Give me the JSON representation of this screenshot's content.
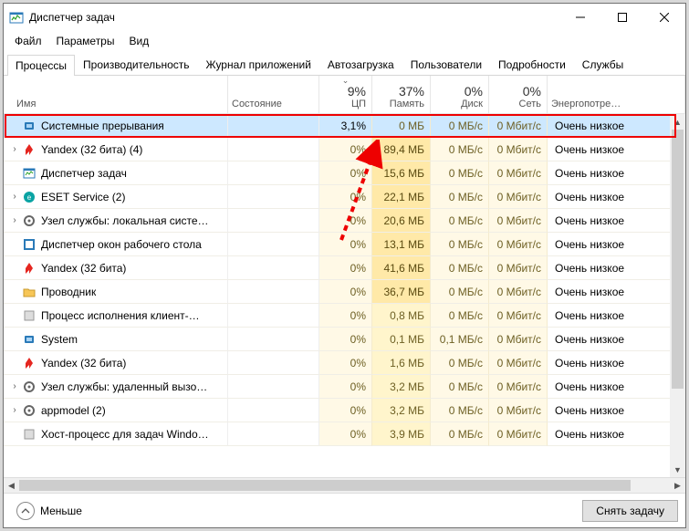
{
  "window": {
    "title": "Диспетчер задач"
  },
  "menu": {
    "file": "Файл",
    "options": "Параметры",
    "view": "Вид"
  },
  "tabs": {
    "processes": "Процессы",
    "performance": "Производительность",
    "apphistory": "Журнал приложений",
    "startup": "Автозагрузка",
    "users": "Пользователи",
    "details": "Подробности",
    "services": "Службы"
  },
  "columns": {
    "name": "Имя",
    "status": "Состояние",
    "cpu": {
      "value": "9%",
      "label": "ЦП"
    },
    "mem": {
      "value": "37%",
      "label": "Память"
    },
    "disk": {
      "value": "0%",
      "label": "Диск"
    },
    "net": {
      "value": "0%",
      "label": "Сеть"
    },
    "power": "Энергопотре…"
  },
  "rows": [
    {
      "icon": "system",
      "expandable": false,
      "selected": true,
      "name": "Системные прерывания",
      "cpu": "3,1%",
      "mem": "0 МБ",
      "disk": "0 МБ/с",
      "net": "0 Мбит/с",
      "pwr": "Очень низкое",
      "mem_hot": false
    },
    {
      "icon": "yandex",
      "expandable": true,
      "selected": false,
      "name": "Yandex (32 бита) (4)",
      "cpu": "0%",
      "mem": "89,4 МБ",
      "disk": "0 МБ/с",
      "net": "0 Мбит/с",
      "pwr": "Очень низкое",
      "mem_hot": true
    },
    {
      "icon": "taskmgr",
      "expandable": false,
      "selected": false,
      "name": "Диспетчер задач",
      "cpu": "0%",
      "mem": "15,6 МБ",
      "disk": "0 МБ/с",
      "net": "0 Мбит/с",
      "pwr": "Очень низкое",
      "mem_hot": true
    },
    {
      "icon": "eset",
      "expandable": true,
      "selected": false,
      "name": "ESET Service (2)",
      "cpu": "0%",
      "mem": "22,1 МБ",
      "disk": "0 МБ/с",
      "net": "0 Мбит/с",
      "pwr": "Очень низкое",
      "mem_hot": true
    },
    {
      "icon": "svc",
      "expandable": true,
      "selected": false,
      "name": "Узел службы: локальная систе…",
      "cpu": "0%",
      "mem": "20,6 МБ",
      "disk": "0 МБ/с",
      "net": "0 Мбит/с",
      "pwr": "Очень низкое",
      "mem_hot": true
    },
    {
      "icon": "dwm",
      "expandable": false,
      "selected": false,
      "name": "Диспетчер окон рабочего стола",
      "cpu": "0%",
      "mem": "13,1 МБ",
      "disk": "0 МБ/с",
      "net": "0 Мбит/с",
      "pwr": "Очень низкое",
      "mem_hot": true
    },
    {
      "icon": "yandex",
      "expandable": false,
      "selected": false,
      "name": "Yandex (32 бита)",
      "cpu": "0%",
      "mem": "41,6 МБ",
      "disk": "0 МБ/с",
      "net": "0 Мбит/с",
      "pwr": "Очень низкое",
      "mem_hot": true
    },
    {
      "icon": "explorer",
      "expandable": false,
      "selected": false,
      "name": "Проводник",
      "cpu": "0%",
      "mem": "36,7 МБ",
      "disk": "0 МБ/с",
      "net": "0 Мбит/с",
      "pwr": "Очень низкое",
      "mem_hot": true
    },
    {
      "icon": "generic",
      "expandable": false,
      "selected": false,
      "name": "Процесс исполнения клиент-…",
      "cpu": "0%",
      "mem": "0,8 МБ",
      "disk": "0 МБ/с",
      "net": "0 Мбит/с",
      "pwr": "Очень низкое",
      "mem_hot": false
    },
    {
      "icon": "system",
      "expandable": false,
      "selected": false,
      "name": "System",
      "cpu": "0%",
      "mem": "0,1 МБ",
      "disk": "0,1 МБ/с",
      "net": "0 Мбит/с",
      "pwr": "Очень низкое",
      "mem_hot": false
    },
    {
      "icon": "yandex",
      "expandable": false,
      "selected": false,
      "name": "Yandex (32 бита)",
      "cpu": "0%",
      "mem": "1,6 МБ",
      "disk": "0 МБ/с",
      "net": "0 Мбит/с",
      "pwr": "Очень низкое",
      "mem_hot": false
    },
    {
      "icon": "svc",
      "expandable": true,
      "selected": false,
      "name": "Узел службы: удаленный вызо…",
      "cpu": "0%",
      "mem": "3,2 МБ",
      "disk": "0 МБ/с",
      "net": "0 Мбит/с",
      "pwr": "Очень низкое",
      "mem_hot": false
    },
    {
      "icon": "svc",
      "expandable": true,
      "selected": false,
      "name": "appmodel (2)",
      "cpu": "0%",
      "mem": "3,2 МБ",
      "disk": "0 МБ/с",
      "net": "0 Мбит/с",
      "pwr": "Очень низкое",
      "mem_hot": false
    },
    {
      "icon": "generic",
      "expandable": false,
      "selected": false,
      "name": "Хост-процесс для задач Windo…",
      "cpu": "0%",
      "mem": "3,9 МБ",
      "disk": "0 МБ/с",
      "net": "0 Мбит/с",
      "pwr": "Очень низкое",
      "mem_hot": false
    }
  ],
  "status": {
    "fewer": "Меньше",
    "end_task": "Снять задачу"
  }
}
